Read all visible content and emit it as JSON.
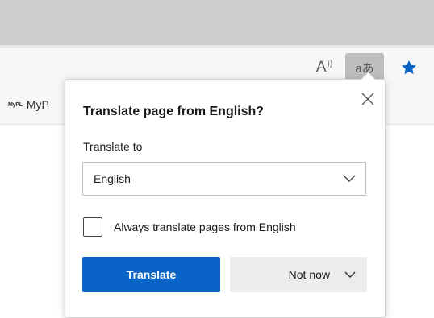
{
  "toolbar": {
    "read_aloud_icon": "A",
    "translate_icon": "aあ",
    "favorite_icon": "star-icon",
    "accent_color": "#0a64c8"
  },
  "favorites_bar": {
    "logo_text": "MyPL",
    "item_label": "MyP"
  },
  "translate_popup": {
    "heading": "Translate page from English?",
    "translate_to_label": "Translate to",
    "selected_language": "English",
    "always_translate_label": "Always translate pages from English",
    "always_translate_checked": false,
    "translate_button": "Translate",
    "not_now_button": "Not now"
  }
}
